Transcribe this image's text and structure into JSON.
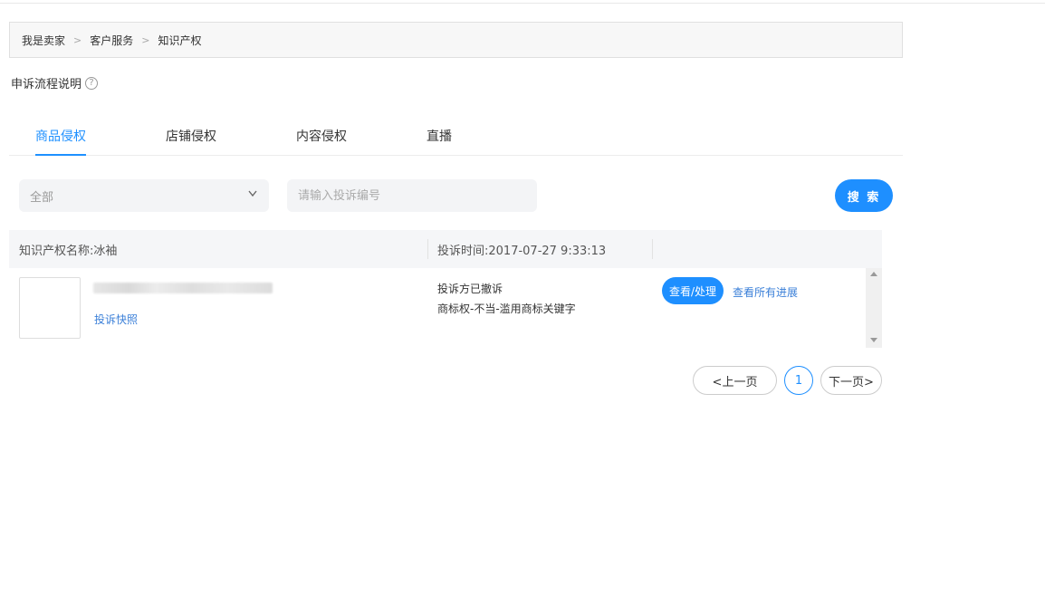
{
  "breadcrumb": {
    "items": [
      "我是卖家",
      "客户服务",
      "知识产权"
    ],
    "separator": ">"
  },
  "help": {
    "label": "申诉流程说明",
    "icon": "question-circle-icon",
    "icon_text": "?"
  },
  "tabs": [
    {
      "label": "商品侵权",
      "active": true
    },
    {
      "label": "店铺侵权",
      "active": false
    },
    {
      "label": "内容侵权",
      "active": false
    },
    {
      "label": "直播",
      "active": false
    }
  ],
  "filter": {
    "select_value": "全部",
    "select_icon": "chevron-down-icon",
    "search_placeholder": "请输入投诉编号",
    "search_button": "搜 索"
  },
  "table": {
    "header": {
      "ip_name": "知识产权名称:冰袖",
      "complaint_time": "投诉时间:2017-07-27 9:33:13"
    },
    "rows": [
      {
        "snapshot_link": "投诉快照",
        "status": "投诉方已撤诉",
        "reason": "商标权-不当-滥用商标关键字",
        "view_button": "查看/处理",
        "progress_link": "查看所有进展"
      }
    ]
  },
  "pagination": {
    "prev": "<上一页",
    "current": "1",
    "next": "下一页>"
  },
  "colors": {
    "accent": "#1e8fff",
    "link": "#3a7fd8"
  }
}
